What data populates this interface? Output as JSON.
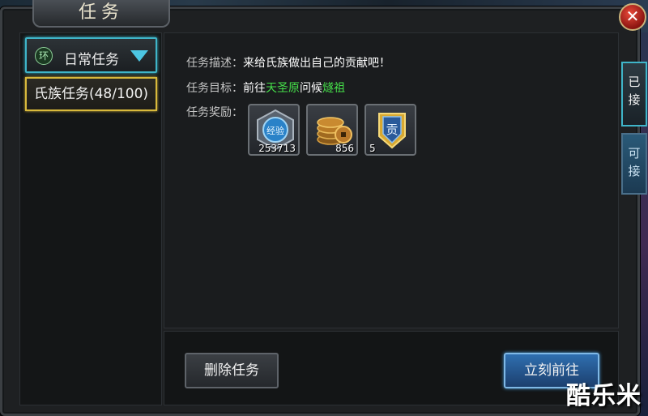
{
  "window": {
    "title": "任务",
    "close_glyph": "✕"
  },
  "sidebar": {
    "category": {
      "icon_text": "环",
      "label": "日常任务",
      "icon": "chevron-down-icon"
    },
    "quests": [
      {
        "label": "氏族任务(48/100)",
        "selected": true
      }
    ]
  },
  "details": {
    "desc_label": "任务描述：",
    "desc_value": "来给氏族做出自己的贡献吧！",
    "target_label": "任务目标：",
    "target_prefix": "前往",
    "target_place": "天圣原",
    "target_mid": "问候",
    "target_npc": "燧祖",
    "reward_label": "任务奖励：",
    "rewards": [
      {
        "name": "exp",
        "icon": "exp-orb-icon",
        "icon_text": "经验",
        "amount": "253713"
      },
      {
        "name": "coins",
        "icon": "coin-stack-icon",
        "amount": "856"
      },
      {
        "name": "contribution",
        "icon": "contribution-badge-icon",
        "icon_text": "贡",
        "amount": "5"
      }
    ]
  },
  "actions": {
    "delete_label": "删除任务",
    "go_label": "立刻前往"
  },
  "side_tabs": {
    "accepted": "已接",
    "available": "可接"
  },
  "watermark": "酷乐米",
  "colors": {
    "highlight_green": "#46e04a",
    "accent_cyan": "#3fb5c9",
    "selected_gold": "#d8b93c"
  }
}
